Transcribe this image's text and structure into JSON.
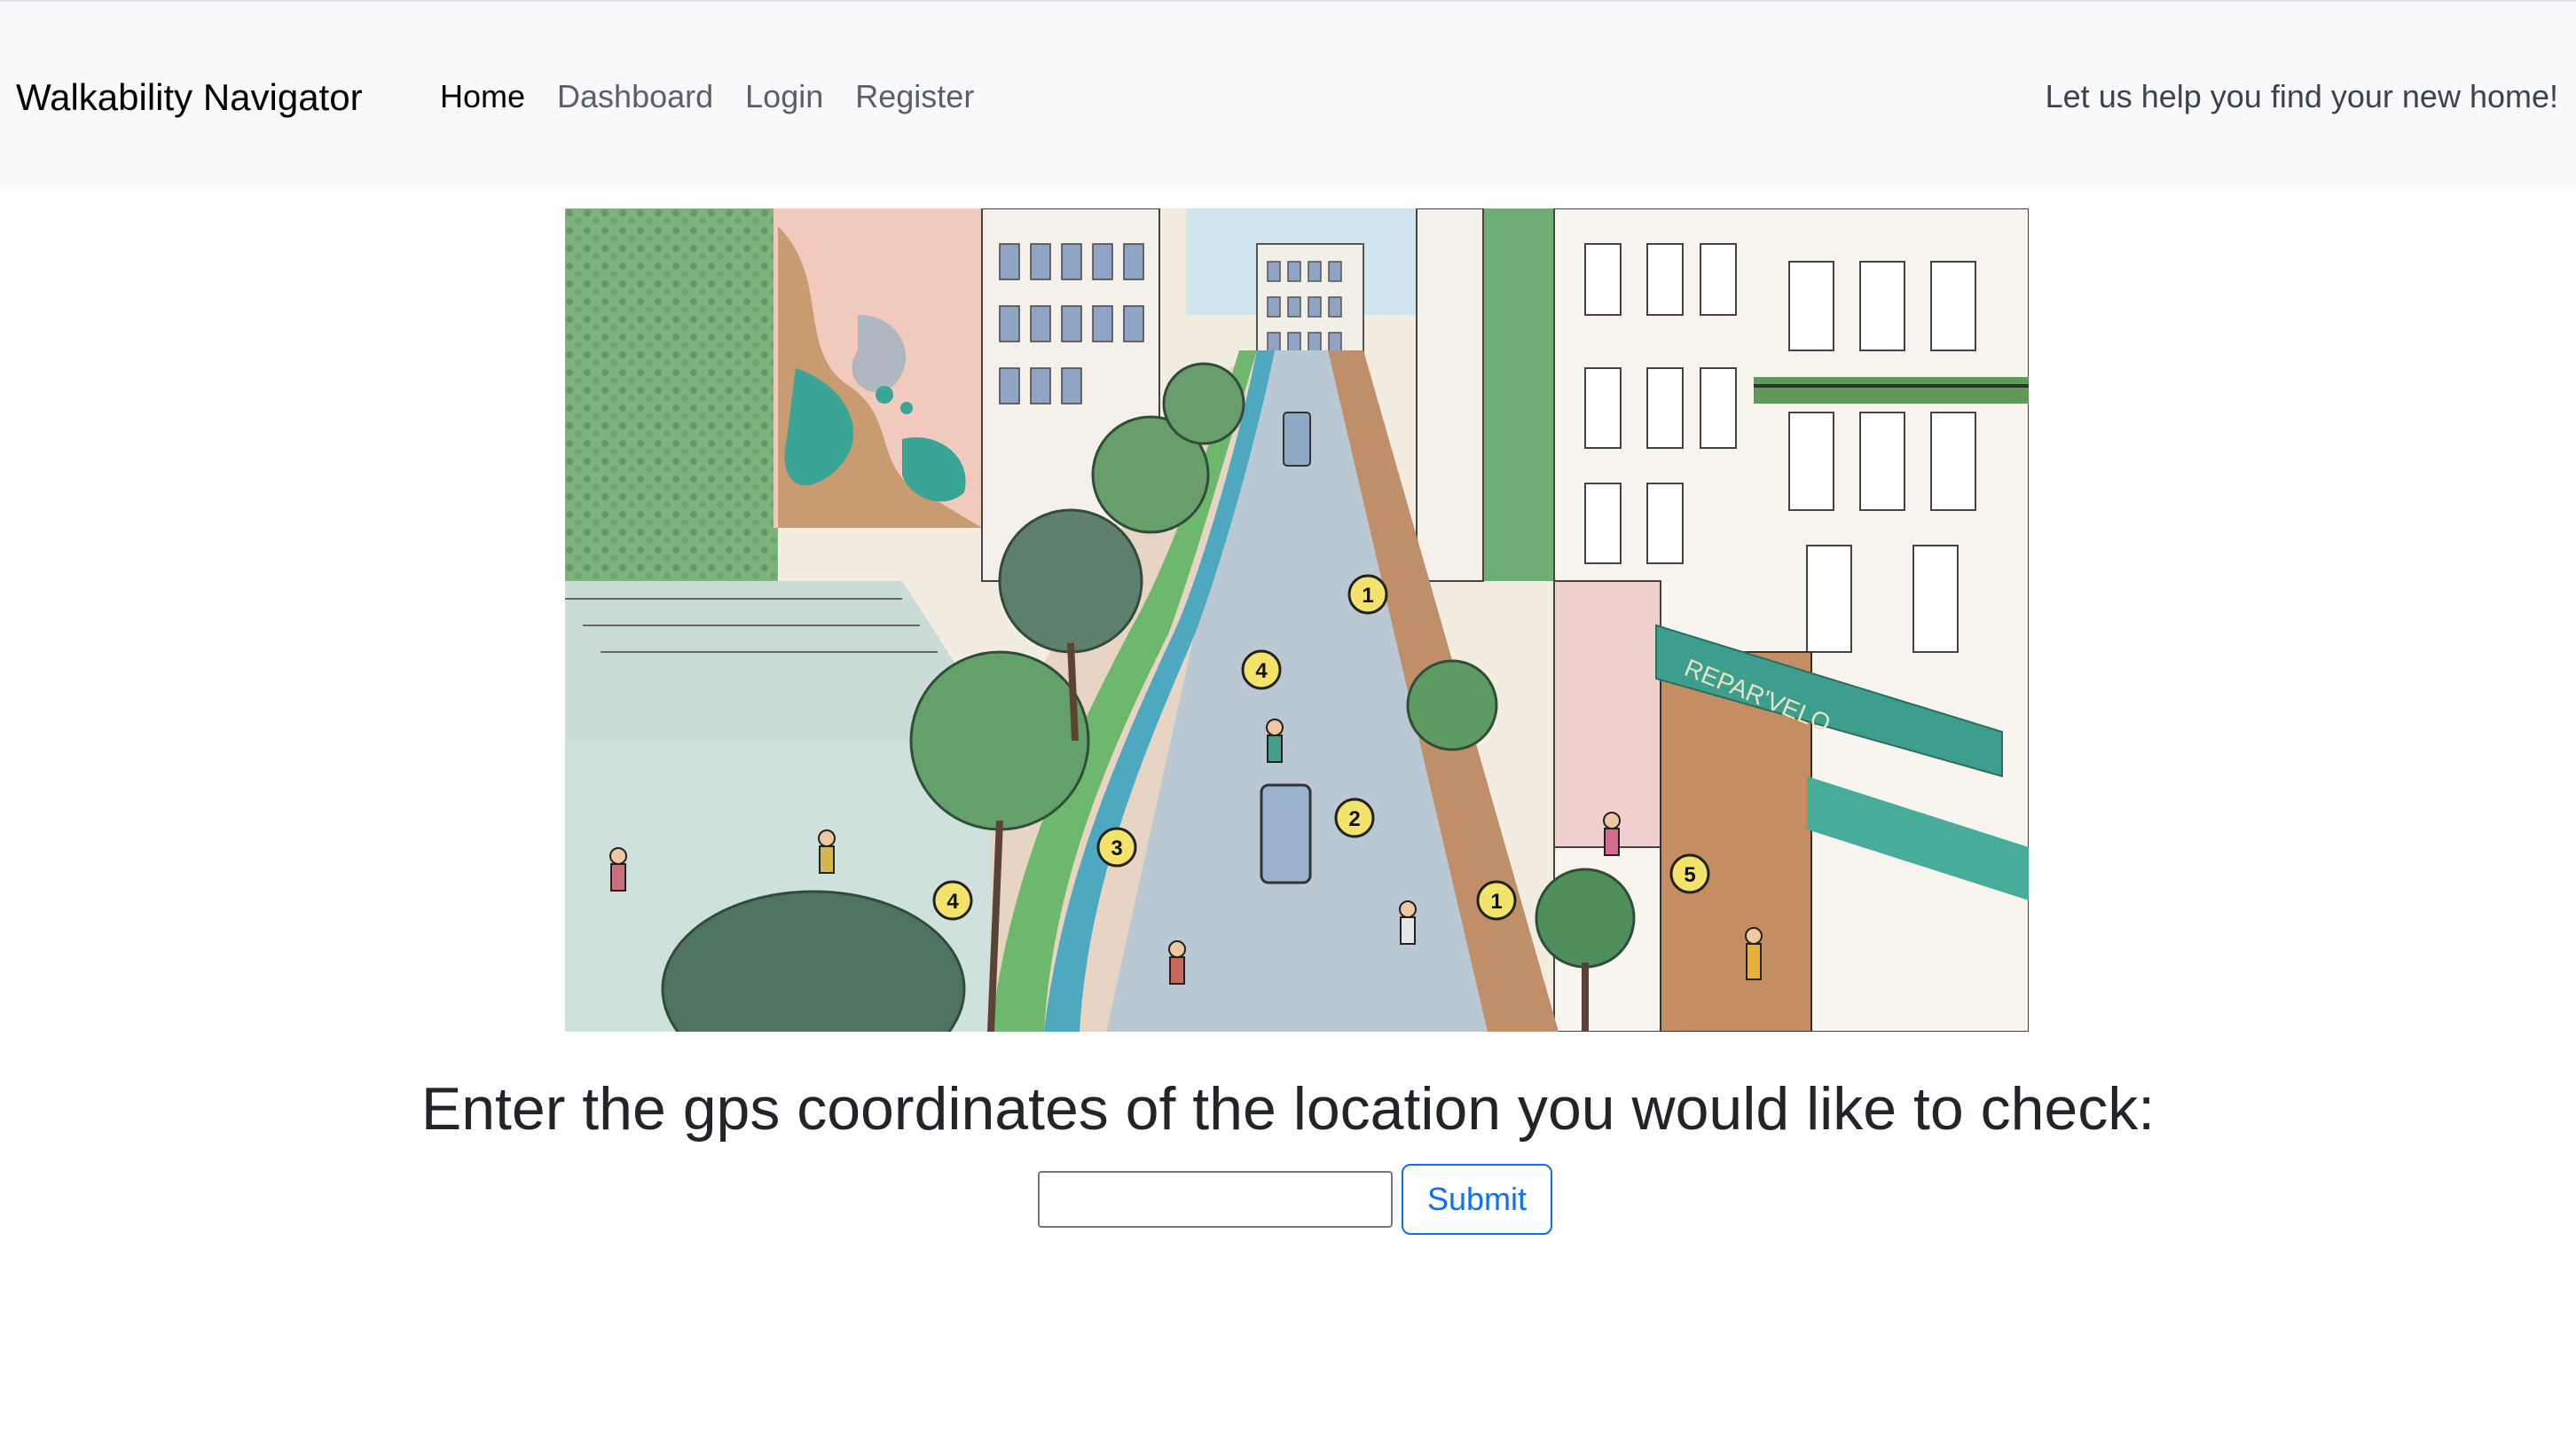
{
  "navbar": {
    "brand": "Walkability Navigator",
    "links": [
      {
        "label": "Home",
        "active": true
      },
      {
        "label": "Dashboard",
        "active": false
      },
      {
        "label": "Login",
        "active": false
      },
      {
        "label": "Register",
        "active": false
      }
    ],
    "tagline": "Let us help you find your new home!"
  },
  "hero": {
    "markers": [
      "1",
      "4",
      "2",
      "3",
      "4",
      "1",
      "5"
    ],
    "shop_sign": "REPAR'VELO"
  },
  "main": {
    "prompt": "Enter the gps coordinates of the location you would like to check:",
    "coords_value": "",
    "submit_label": "Submit"
  },
  "colors": {
    "navbar_bg": "#f8f9fa",
    "accent": "#0d6efd",
    "marker": "#f3e36b"
  }
}
